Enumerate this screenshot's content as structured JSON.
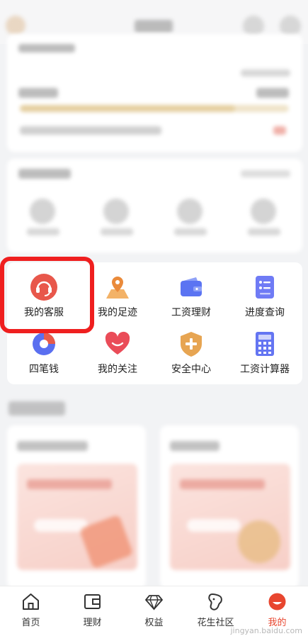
{
  "services": [
    {
      "label": "我的客服",
      "icon": "customer-service-headset-icon"
    },
    {
      "label": "我的足迹",
      "icon": "footprint-map-pin-icon"
    },
    {
      "label": "工资理财",
      "icon": "wallet-icon"
    },
    {
      "label": "进度查询",
      "icon": "checklist-icon"
    },
    {
      "label": "四笔钱",
      "icon": "pie-chart-icon"
    },
    {
      "label": "我的关注",
      "icon": "heart-icon"
    },
    {
      "label": "安全中心",
      "icon": "shield-plus-icon"
    },
    {
      "label": "工资计算器",
      "icon": "calculator-icon"
    }
  ],
  "tabs": [
    {
      "label": "首页",
      "icon": "home-icon"
    },
    {
      "label": "理财",
      "icon": "wallet-outline-icon"
    },
    {
      "label": "权益",
      "icon": "diamond-icon"
    },
    {
      "label": "花生社区",
      "icon": "peanut-icon"
    },
    {
      "label": "我的",
      "icon": "profile-face-icon"
    }
  ],
  "active_tab": "我的",
  "watermark": "jingyan.baidu.com",
  "colors": {
    "accent_red": "#e8462f",
    "highlight_red": "#ef1f1f",
    "page_bg": "#f2f3f5"
  }
}
